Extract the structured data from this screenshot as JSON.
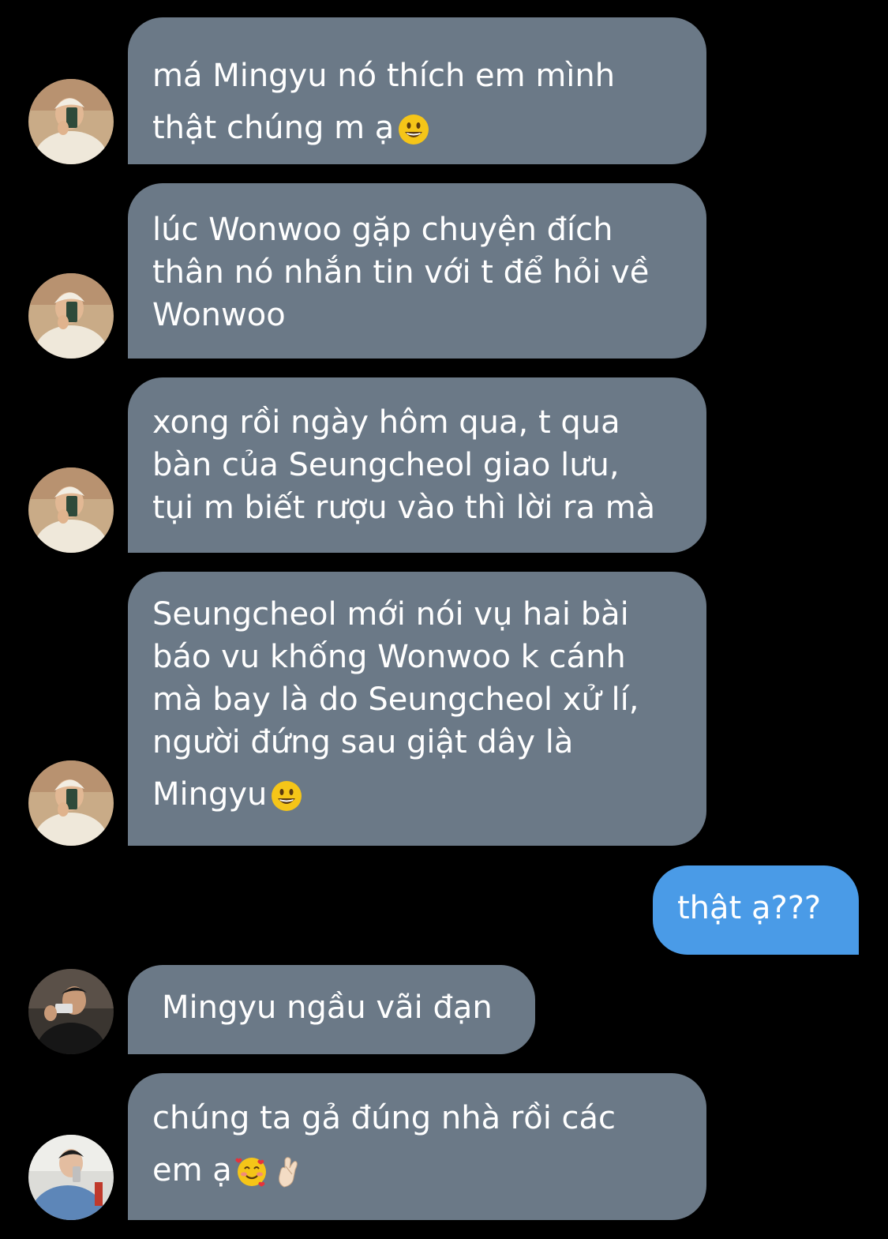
{
  "conversation": {
    "messages": [
      {
        "sender": "a",
        "lines": [
          "má Mingyu nó thích em mình",
          "thật chúng m ạ"
        ],
        "trailing_emoji": [
          "grinning-face"
        ]
      },
      {
        "sender": "a",
        "lines": [
          "lúc Wonwoo gặp chuyện đích",
          "thân nó nhắn tin với t để hỏi về",
          "Wonwoo"
        ]
      },
      {
        "sender": "a",
        "lines": [
          "xong rồi ngày hôm qua, t qua",
          "bàn của Seungcheol giao lưu,",
          "tụi m biết rượu vào thì lời ra mà"
        ]
      },
      {
        "sender": "a",
        "lines": [
          "Seungcheol mới nói vụ hai bài",
          "báo vu khống Wonwoo k cánh",
          "mà bay là do Seungcheol xử lí,",
          "người đứng sau giật dây là",
          "Mingyu"
        ],
        "trailing_emoji": [
          "grinning-face"
        ]
      },
      {
        "sender": "me",
        "lines": [
          "thật ạ???"
        ]
      },
      {
        "sender": "b",
        "lines": [
          "Mingyu ngầu vãi đạn"
        ]
      },
      {
        "sender": "c",
        "lines": [
          "chúng ta gả đúng nhà rồi các",
          "em ạ"
        ],
        "trailing_emoji": [
          "smiling-face-with-hearts",
          "crossed-fingers"
        ]
      }
    ]
  },
  "colors": {
    "background": "#000000",
    "incoming_bubble": "#6b7987",
    "outgoing_bubble": "#4a9be7",
    "text": "#ffffff"
  },
  "icons": {
    "avatar_a": "avatar-beanie-selfie",
    "avatar_b": "avatar-black-shirt-selfie",
    "avatar_c": "avatar-denim-jacket-selfie"
  }
}
